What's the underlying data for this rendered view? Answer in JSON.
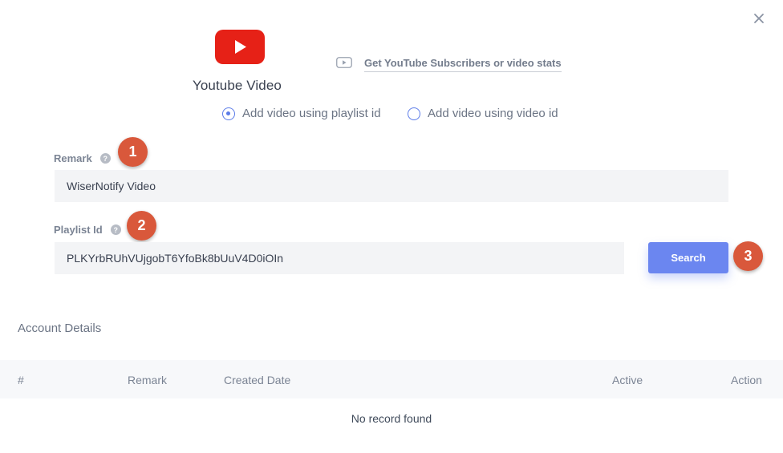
{
  "modal": {
    "title": "Youtube Video",
    "stats_link": "Get YouTube Subscribers or video stats",
    "radio_options": [
      {
        "label": "Add video using playlist id",
        "checked": true
      },
      {
        "label": "Add video using video id",
        "checked": false
      }
    ]
  },
  "form": {
    "remark_label": "Remark",
    "remark_value": "WiserNotify Video",
    "playlist_label": "Playlist Id",
    "playlist_value": "PLKYrbRUhVUjgobT6YfoBk8bUuV4D0iOIn",
    "help_glyph": "?",
    "search_label": "Search"
  },
  "steps": [
    "1",
    "2",
    "3"
  ],
  "account": {
    "section_title": "Account Details",
    "columns": [
      "#",
      "Remark",
      "Created Date",
      "Active",
      "Action"
    ],
    "empty_text": "No record found"
  },
  "colors": {
    "accent": "#6b86f0",
    "youtube_red": "#e62117",
    "step_badge": "#d9583b"
  },
  "icons": {
    "close": "close-icon",
    "logo": "youtube-logo-icon",
    "stats": "play-square-icon",
    "help": "help-icon"
  }
}
